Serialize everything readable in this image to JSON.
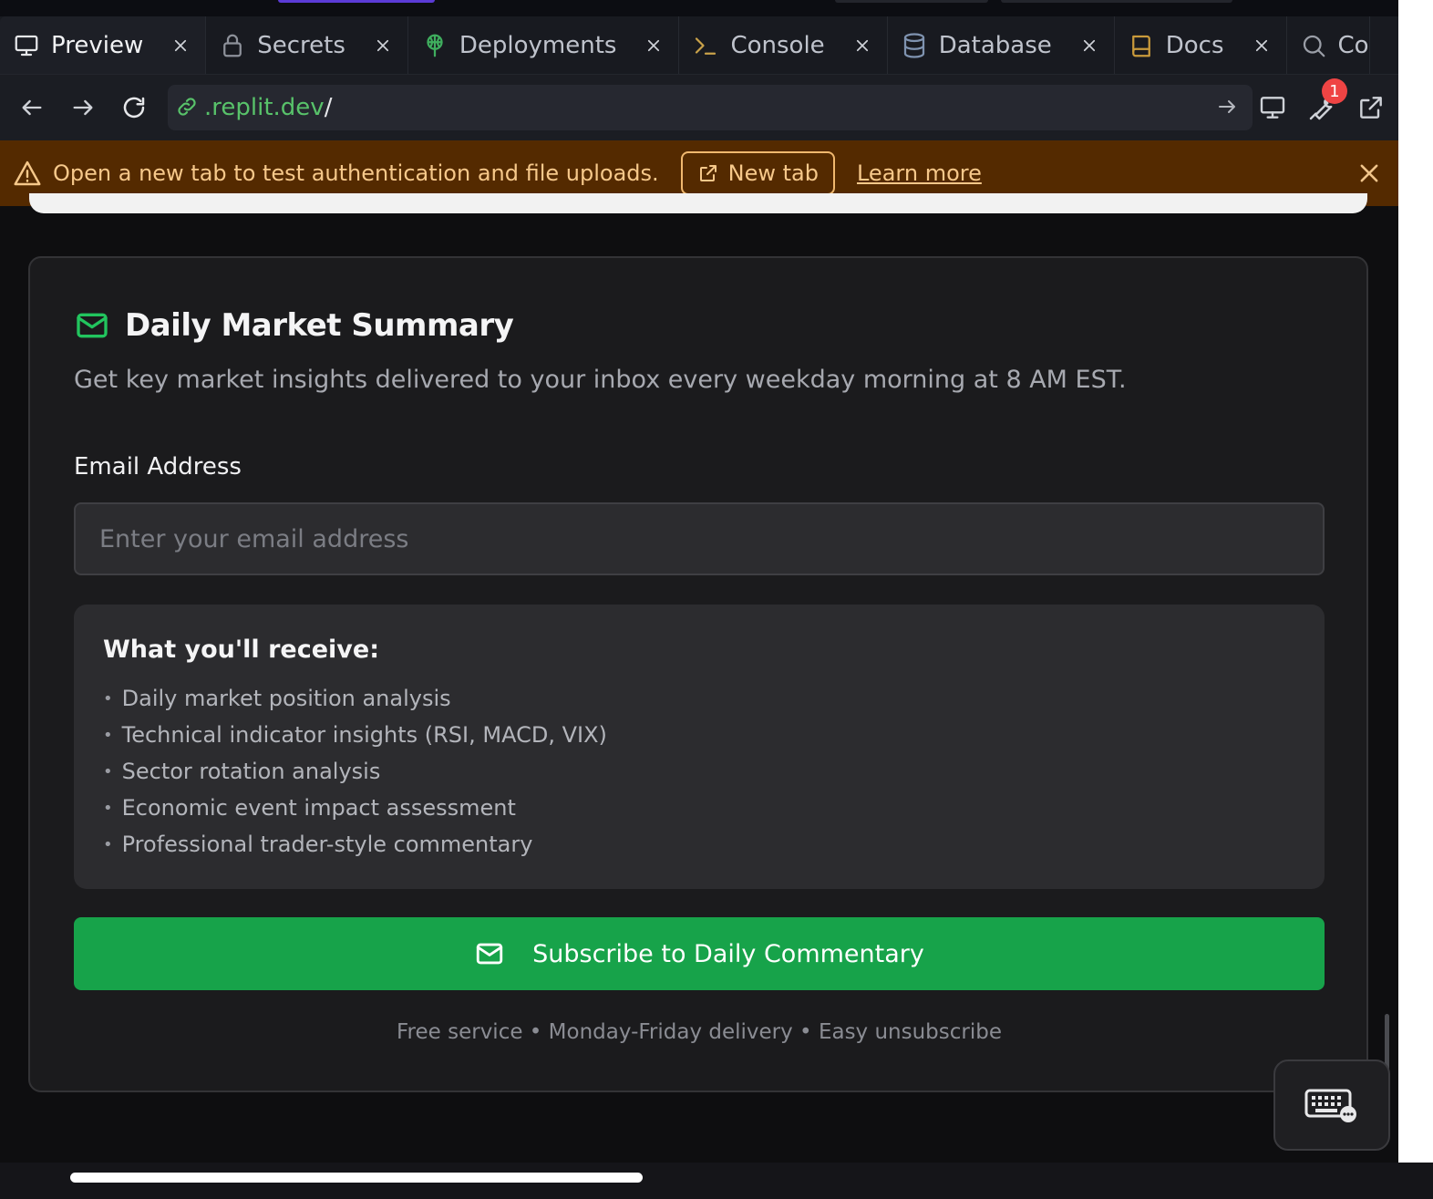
{
  "tabs": [
    {
      "label": "Preview",
      "icon": "monitor-icon",
      "active": true
    },
    {
      "label": "Secrets",
      "icon": "lock-icon"
    },
    {
      "label": "Deployments",
      "icon": "deploy-icon"
    },
    {
      "label": "Console",
      "icon": "terminal-icon"
    },
    {
      "label": "Database",
      "icon": "database-icon"
    },
    {
      "label": "Docs",
      "icon": "book-icon"
    },
    {
      "label": "Co",
      "icon": "search-icon"
    }
  ],
  "address_bar": {
    "url_domain": ".replit.dev",
    "url_path": "/",
    "devtools_badge": "1"
  },
  "banner": {
    "message": "Open a new tab to test authentication and file uploads.",
    "new_tab_label": "New tab",
    "learn_more_label": "Learn more"
  },
  "card": {
    "title": "Daily Market Summary",
    "description": "Get key market insights delivered to your inbox every weekday morning at 8 AM EST.",
    "email_label": "Email Address",
    "email_placeholder": "Enter your email address",
    "email_value": "",
    "receive_title": "What you'll receive:",
    "receive_items": [
      "Daily market position analysis",
      "Technical indicator insights (RSI, MACD, VIX)",
      "Sector rotation analysis",
      "Economic event impact assessment",
      "Professional trader-style commentary"
    ],
    "subscribe_label": "Subscribe to Daily Commentary",
    "footer_note": "Free service • Monday-Friday delivery • Easy unsubscribe"
  },
  "colors": {
    "accent_green": "#17a34a",
    "banner_bg": "#542a00",
    "banner_text": "#f6c88a",
    "badge_red": "#ef4444"
  }
}
